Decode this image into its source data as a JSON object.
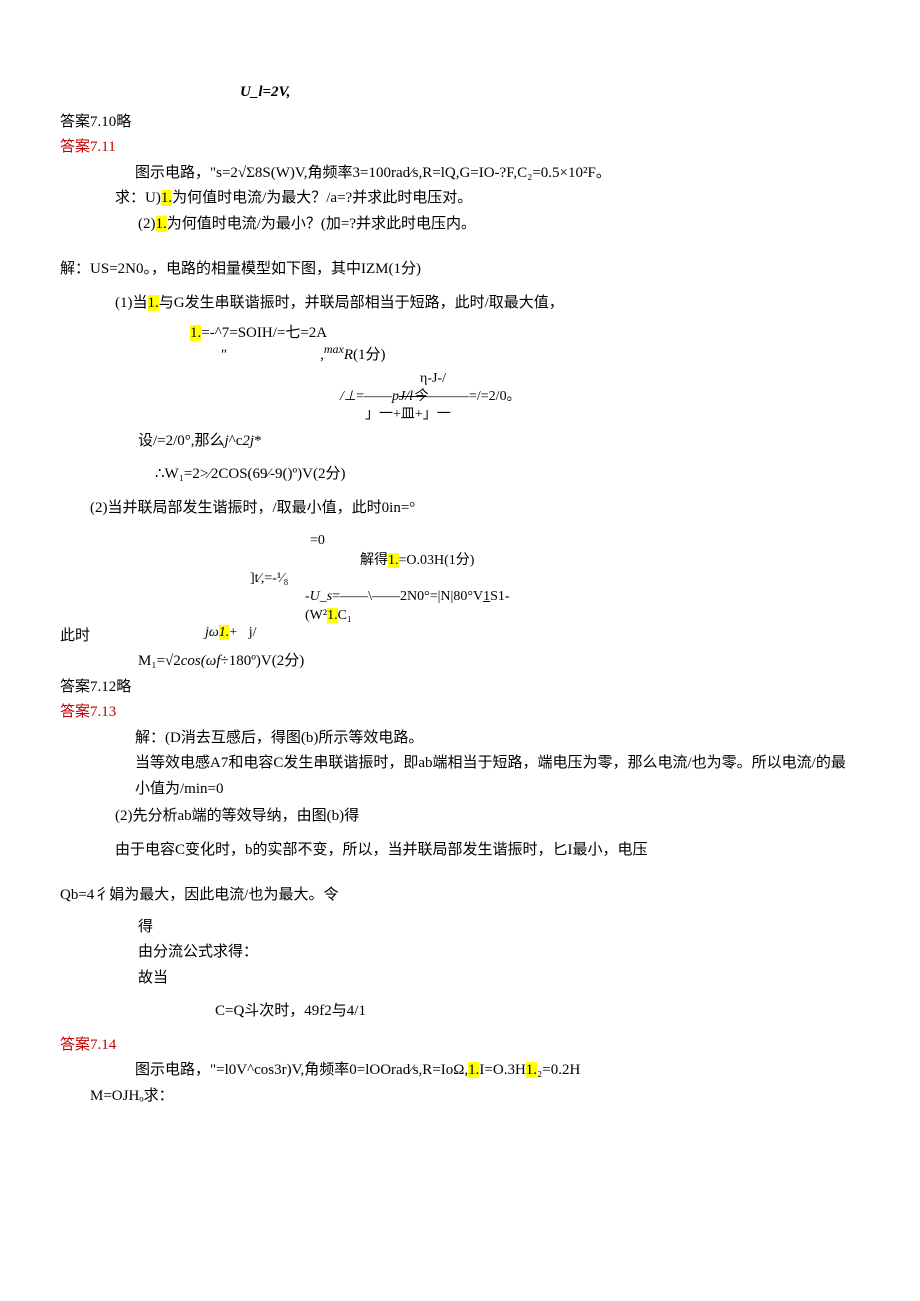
{
  "line_top": "U_l=2V,",
  "ans710": "答案7.10略",
  "ans711_title": "答案7.11",
  "ans711_l1": "图示电路，\"s=2√Σ8S(W)V,角频率3=100rad⁄s,R=lQ,G=IO-?F,C₂=0.5×10²F。",
  "ans711_l2a": "求：U)",
  "ans711_l2b": "1.",
  "ans711_l2c": "为何值时电流/为最大？/a=?并求此时电压对。",
  "ans711_l3a": "(2)",
  "ans711_l3b": "1.",
  "ans711_l3c": "为何值时电流/为最小？(加=?并求此时电压内。",
  "ans711_sol": "解：US=2N0。，电路的相量模型如下图，其中IZM(1分)",
  "ans711_p1a": "(1)当",
  "ans711_p1b": "1.",
  "ans711_p1c": "与G发生串联谐振时，并联局部相当于短路，此时/取最大值，",
  "ans711_f1a": "1.",
  "ans711_f1b": "=-^7=SOIH/=七=2A",
  "ans711_f1c": "\"",
  "ans711_f1d": ",maxR(1分)",
  "ans711_f2a": "η-J-/",
  "ans711_f2b": "/⊥=——pJ/l今———=/=2/0。",
  "ans711_f2c": "」一+皿+」一",
  "ans711_set": "设/=2/0°,那么j^c2j*",
  "ans711_w1": "∴W₁=2>⁄2COS(69⁄-9()º)V(2分)",
  "ans711_p2": "(2)当并联局部发生谐振时，/取最小值，此时0in=°",
  "ans711_f3a": "=0",
  "ans711_f3b_a": "解得",
  "ans711_f3b_b": "1.",
  "ans711_f3b_c": "=O.03H(1分)",
  "ans711_f3c": "]t⁄,=-¹⁄₈",
  "ans711_f3d_a": "-U_s=——\\——2N0°=|N|80°V1S1-",
  "ans711_f3d_b": "(W²",
  "ans711_f3d_c": "1.",
  "ans711_f3d_d": "C₁",
  "ans711_f3e_a": "jω",
  "ans711_f3e_b": "1.",
  "ans711_f3e_c": "+",
  "ans711_f3e_d": "j/",
  "ans711_now": "此时",
  "ans711_m1": "M₁=√2cos(ωf÷180º)V(2分)",
  "ans712": "答案7.12略",
  "ans713_title": "答案7.13",
  "ans713_l1": "解：(D消去互感后，得图(b)所示等效电路。",
  "ans713_l2": "当等效电感A7和电容C发生串联谐振时，即ab端相当于短路，端电压为零，那么电流/也为零。所以电流/的最小值为/min=0",
  "ans713_l3": "(2)先分析ab端的等效导纳，由图(b)得",
  "ans713_l4": "由于电容C变化时，b的实部不变，所以，当并联局部发生谐振时，匕I最小，电压",
  "ans713_l5": "Qb=4彳娟为最大，因此电流/也为最大。令",
  "ans713_l6": "得",
  "ans713_l7": "由分流公式求得：",
  "ans713_l8": "故当",
  "ans713_l9": "C=Q斗次时，49f2与4/1",
  "ans714_title": "答案7.14",
  "ans714_l1a": "图示电路，\"=l0V^cos3r)V,角频率0=lOOrad⁄s,R=IoΩ,",
  "ans714_l1b": "1.",
  "ans714_l1c": "I=O.3H",
  "ans714_l1d": "1.",
  "ans714_l1e": "₂=0.2H",
  "ans714_l2": "M=OJHₒ求："
}
